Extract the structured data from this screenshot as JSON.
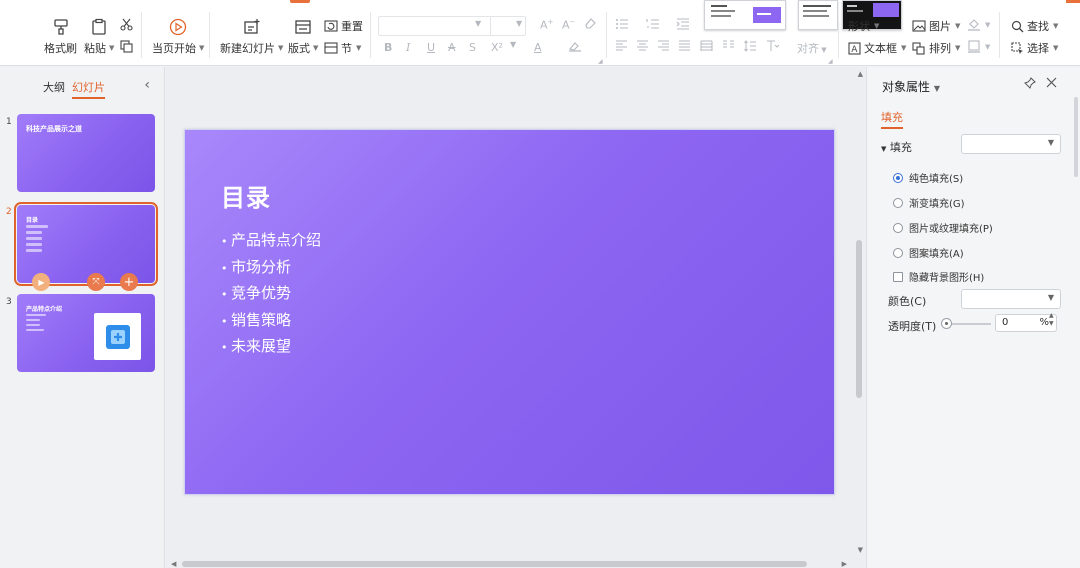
{
  "ribbon": {
    "format_painter": "格式刷",
    "paste": "粘贴",
    "from_current": "当页开始",
    "new_slide": "新建幻灯片",
    "layout": "版式",
    "reset": "重置",
    "section": "节",
    "align": "对齐",
    "shape": "形状",
    "picture": "图片",
    "textbox": "文本框",
    "arrange": "排列",
    "find": "查找",
    "select": "选择",
    "accent_color": "#e8703a"
  },
  "left_panel": {
    "tab_outline": "大纲",
    "tab_slides": "幻灯片",
    "slides": [
      {
        "number": "1",
        "title": "科技产品展示之道"
      },
      {
        "number": "2",
        "title": "目录"
      },
      {
        "number": "3",
        "title": "产品特点介绍"
      }
    ]
  },
  "slide": {
    "title": "目录",
    "items": [
      "产品特点介绍",
      "市场分析",
      "竞争优势",
      "销售策略",
      "未来展望"
    ],
    "gradient_start": "#a888fb",
    "gradient_end": "#7f57ea"
  },
  "properties": {
    "title": "对象属性",
    "tab_fill": "填充",
    "fill_label": "填充",
    "options": [
      "纯色填充(S)",
      "渐变填充(G)",
      "图片或纹理填充(P)",
      "图案填充(A)"
    ],
    "selected_option": "纯色填充(S)",
    "hide_background": "隐藏背景图形(H)",
    "color_label": "颜色(C)",
    "transparency_label": "透明度(T)",
    "transparency_value": "0",
    "transparency_unit": "%"
  }
}
